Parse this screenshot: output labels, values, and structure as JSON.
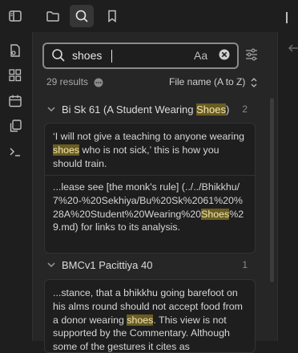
{
  "search": {
    "query": "shoes",
    "match_case_label": "Aa"
  },
  "results": {
    "count_label": "29 results",
    "sort_label": "File name (A to Z)"
  },
  "groups": [
    {
      "title_before": "Bi Sk 61 (A Student Wearing ",
      "title_match": "Shoes",
      "title_after": ")",
      "count": "2",
      "matches": [
        {
          "before": "‘I will not give a teaching to anyone wearing ",
          "match": "shoes",
          "after": " who is not sick,’ this is how you should train."
        },
        {
          "before": "...lease see [the monk's rule] (../../Bhikkhu/7%20-%20Sekhiya/Bu%20Sk%2061%20%28A%20Student%20Wearing%20",
          "match": "Shoes",
          "after": "%29.md) for links to its analysis."
        }
      ]
    },
    {
      "title_before": "BMCv1 Pacittiya 40",
      "title_match": "",
      "title_after": "",
      "count": "1",
      "matches": [
        {
          "before": "...stance, that a bhikkhu going barefoot on his alms round should not accept food from a donor wearing ",
          "match": "shoes",
          "after": ". This view is not supported by the Commentary. Although some of the gestures it cites as"
        }
      ]
    }
  ],
  "colors": {
    "highlight": "#6b5d22",
    "panel": "#262626",
    "background": "#1e1e1e"
  }
}
